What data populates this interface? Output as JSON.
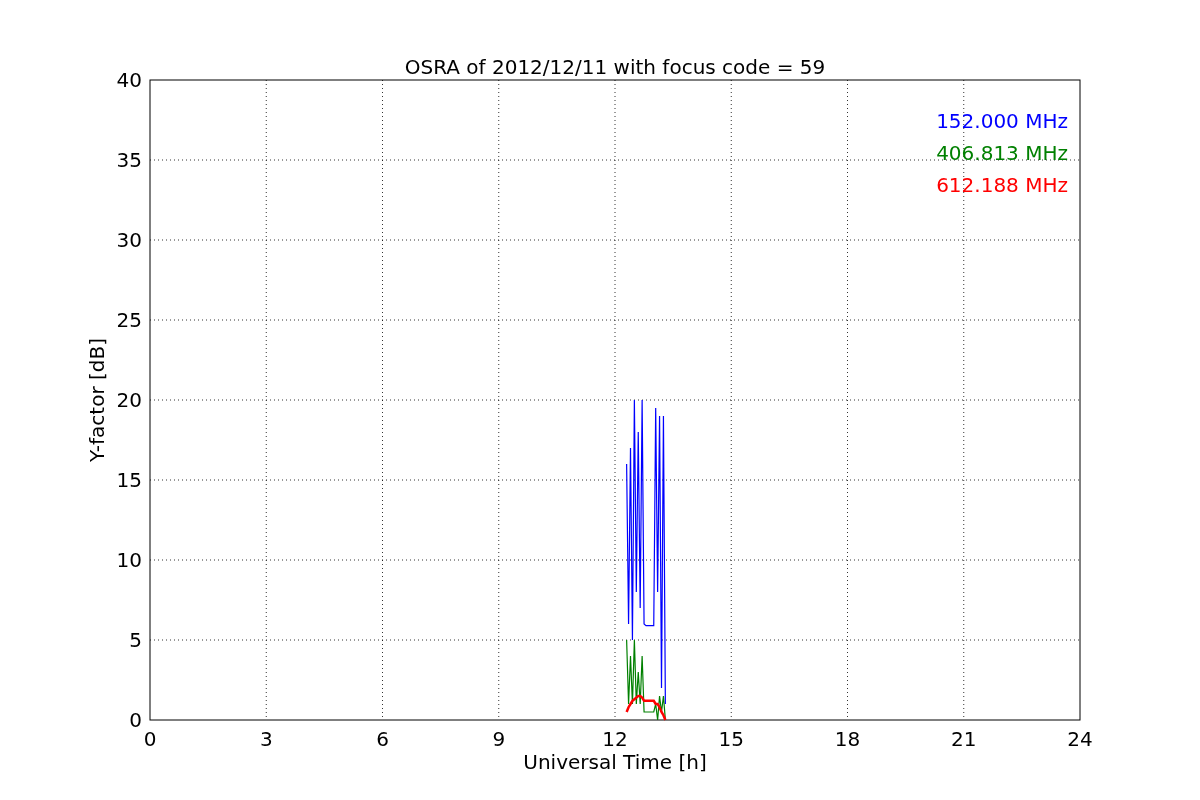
{
  "chart_data": {
    "type": "line",
    "title": "OSRA of 2012/12/11 with focus code = 59",
    "xlabel": "Universal Time [h]",
    "ylabel": "Y-factor [dB]",
    "x": [
      12.3,
      12.35,
      12.4,
      12.45,
      12.5,
      12.55,
      12.6,
      12.65,
      12.7,
      12.75,
      12.8,
      13.0,
      13.05,
      13.1,
      13.15,
      13.2,
      13.25,
      13.3
    ],
    "series": [
      {
        "name": "152.000 MHz",
        "color": "#0000ff",
        "values": [
          16,
          6,
          17,
          5,
          20,
          8,
          18,
          7,
          20,
          6,
          5.9,
          5.9,
          19.5,
          8,
          19,
          2,
          19,
          1
        ]
      },
      {
        "name": "406.813 MHz",
        "color": "#008000",
        "values": [
          5,
          1,
          4,
          1,
          5,
          1,
          3,
          1,
          4,
          0.5,
          0.5,
          0.5,
          1,
          0,
          1.5,
          0.5,
          1.5,
          0
        ]
      },
      {
        "name": "612.188 MHz",
        "color": "#ff0000",
        "values": [
          0.5,
          0.8,
          1,
          1.2,
          1.3,
          1.4,
          1.5,
          1.5,
          1.4,
          1.2,
          1.2,
          1.2,
          1,
          1,
          0.8,
          0.5,
          0.3,
          0
        ]
      }
    ],
    "xlim": [
      0,
      24
    ],
    "ylim": [
      0,
      40
    ],
    "xticks": [
      0,
      3,
      6,
      9,
      12,
      15,
      18,
      21,
      24
    ],
    "yticks": [
      0,
      5,
      10,
      15,
      20,
      25,
      30,
      35,
      40
    ],
    "grid": true
  }
}
